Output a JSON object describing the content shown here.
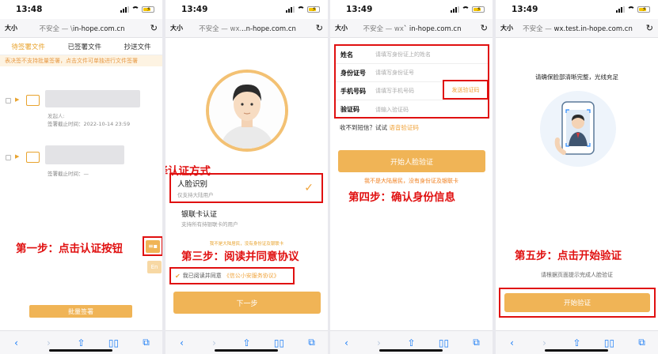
{
  "panels": [
    {
      "time": "13:48",
      "url_prefix": "不安全 — \\",
      "url_host": "in-hope.com.cn"
    },
    {
      "time": "13:49",
      "url_prefix": "不安全 — wx.",
      "url_host": "..n-hope.com.cn"
    },
    {
      "time": "13:49",
      "url_prefix": "不安全 — wx",
      "url_host": "` in-hope.com.cn"
    },
    {
      "time": "13:49",
      "url_prefix": "不安全 — ",
      "url_host": "wx.test.in-hope.com.cn"
    }
  ],
  "browser": {
    "text_size": "大小",
    "reload_icon": "reload-icon"
  },
  "panel1": {
    "tabs": [
      "待签署文件",
      "已签署文件",
      "抄送文件"
    ],
    "warning": "表决签不支持批量签署，点击文件可单独进行文件签署",
    "doc1": {
      "subtitle": "发起人:",
      "deadline": "签署截止时间：2022-10-14 23:59"
    },
    "doc2": {
      "deadline": "签署截止时间：—"
    },
    "step1": "第一步：点击认证按钮",
    "en_label": "En",
    "batch_sign": "批量签署"
  },
  "panel2": {
    "step2": "第二步：选择认证方式",
    "face_title": "人脸识别",
    "face_sub": "仅支持大陆用户",
    "bank_title": "银联卡认证",
    "bank_sub": "支持所有持银联卡的用户",
    "hint": "我不是大陆居民，没有身份证及银联卡",
    "step3": "第三步：阅读并同意协议",
    "agree_text": "我已阅读并同意",
    "agree_link": "《信公小安服务协议》",
    "next": "下一步"
  },
  "panel3": {
    "fields": [
      {
        "label": "姓名",
        "placeholder": "请填写身份证上的姓名"
      },
      {
        "label": "身份证号",
        "placeholder": "请填写身份证号"
      },
      {
        "label": "手机号码",
        "placeholder": "请填写手机号码"
      },
      {
        "label": "验证码",
        "placeholder": "请输入验证码"
      }
    ],
    "send_code": "发送验证码",
    "no_sms": "收不到短信？试试",
    "voice_code": "语音验证码",
    "start_face": "开始人脸验证",
    "not_mainland": "我不是大陆居民，没有身份证及银联卡",
    "step4": "第四步：确认身份信息"
  },
  "panel4": {
    "hint": "请确保脸部清晰完整，光线充足",
    "step5": "第五步：点击开始验证",
    "guide": "请根据页面提示完成人脸验证",
    "start": "开始验证"
  },
  "toolbar": {
    "icons": [
      "back-icon",
      "forward-icon",
      "share-icon",
      "bookmarks-icon",
      "tabs-icon"
    ]
  },
  "colors": {
    "accent": "#f0b456",
    "annotation_red": "#e01010",
    "link_orange": "#f0a33a"
  }
}
